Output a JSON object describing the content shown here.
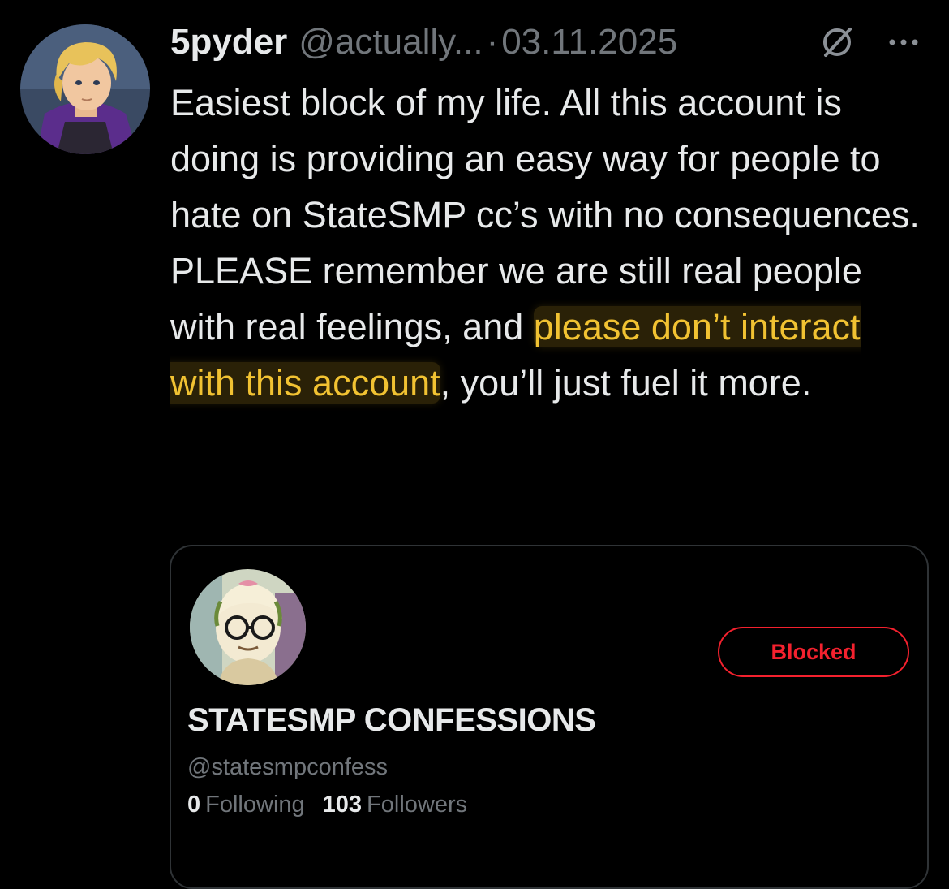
{
  "tweet": {
    "author_name": "5pyder",
    "author_handle": "@actually...",
    "separator": "·",
    "date": "03.11.2025",
    "icons": [
      "grok-icon",
      "more-icon"
    ],
    "text_before": "Easiest block of my life. All this account is doing is providing an easy way for people to hate on StateSMP cc’s with no consequences. PLEASE remember we are still real people with real feelings, and ",
    "text_highlighted": "please don’t interact with this account",
    "text_after": ", you’ll just fuel it more."
  },
  "profile_card": {
    "name": "STATESMP CONFESSIONS",
    "handle": "@statesmpconfess",
    "following_count": "0",
    "following_label": "Following",
    "followers_count": "103",
    "followers_label": "Followers",
    "blocked_label": "Blocked"
  },
  "colors": {
    "background": "#000000",
    "primary_text": "#e7e9ea",
    "secondary_text": "#71767b",
    "highlight_text": "#f1c232",
    "blocked_red": "#f4212e",
    "card_border": "#2f3336"
  }
}
